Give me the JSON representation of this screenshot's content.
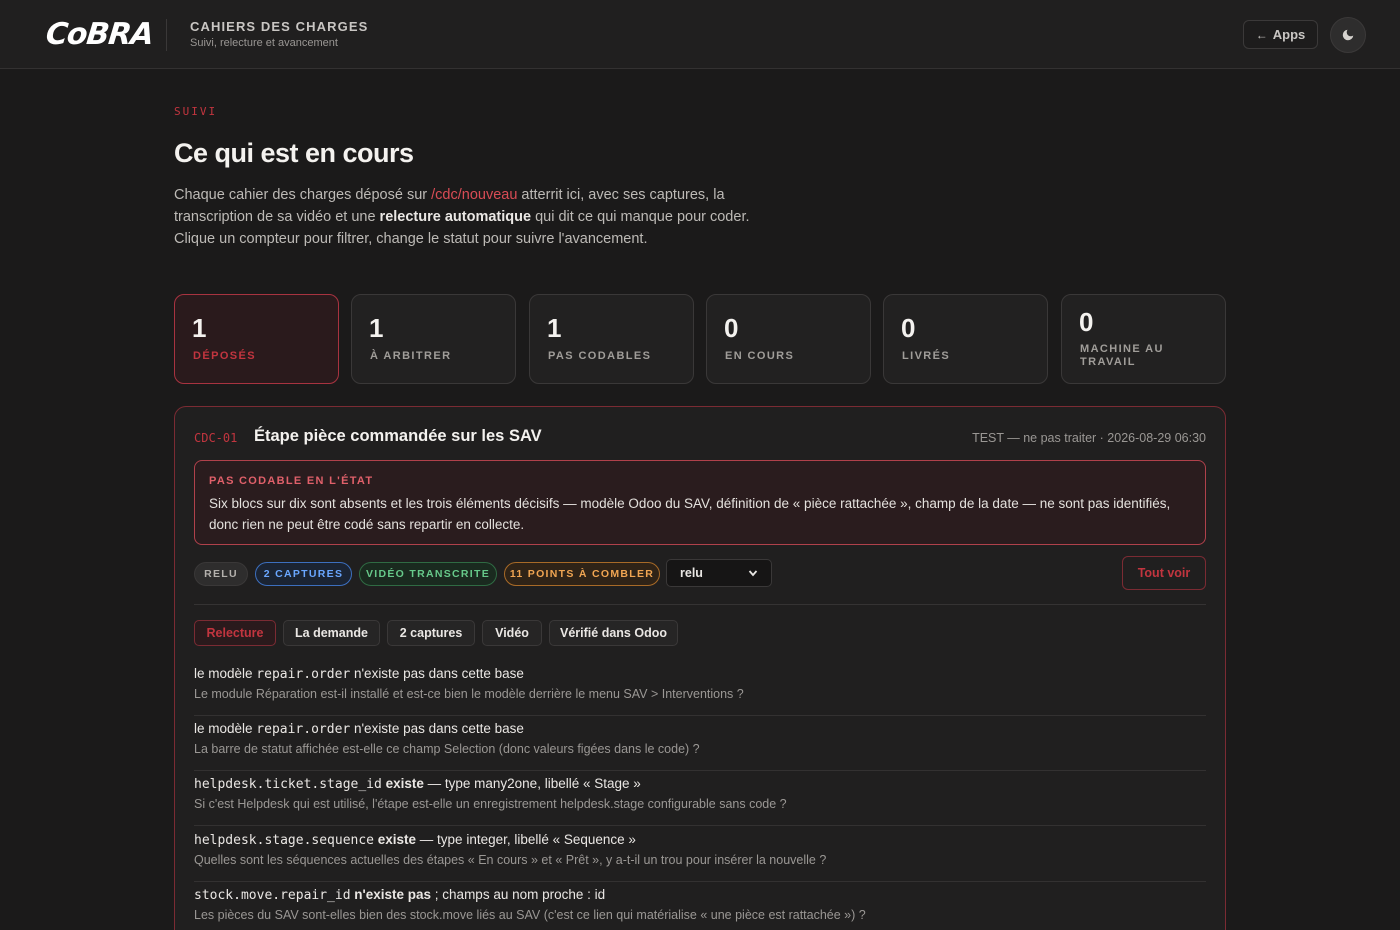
{
  "header": {
    "logo": "CoBRA",
    "title": "CAHIERS DES CHARGES",
    "subtitle": "Suivi, relecture et avancement",
    "apps_label": "Apps",
    "theme_icon": "moon-icon"
  },
  "hero": {
    "eyebrow": "SUIVI",
    "title": "Ce qui est en cours",
    "intro_1": "Chaque cahier des charges déposé sur ",
    "intro_link": "/cdc/nouveau",
    "intro_2": " atterrit ici, avec ses captures, la transcription de sa vidéo et une ",
    "intro_bold": "relecture automatique",
    "intro_3": " qui dit ce qui manque pour coder. Clique un compteur pour filtrer, change le statut pour suivre l'avancement."
  },
  "stats": [
    {
      "count": "1",
      "label": "DÉPOSÉS"
    },
    {
      "count": "1",
      "label": "À ARBITRER"
    },
    {
      "count": "1",
      "label": "PAS CODABLES"
    },
    {
      "count": "0",
      "label": "EN COURS"
    },
    {
      "count": "0",
      "label": "LIVRÉS"
    },
    {
      "count": "0",
      "label": "MACHINE AU TRAVAIL"
    }
  ],
  "card": {
    "code": "CDC-01",
    "title": "Étape pièce commandée sur les SAV",
    "meta": "TEST — ne pas traiter · 2026-08-29 06:30",
    "alert_title": "PAS CODABLE EN L'ÉTAT",
    "alert_text": "Six blocs sur dix sont absents et les trois éléments décisifs — modèle Odoo du SAV, définition de « pièce rattachée », champ de la date — ne sont pas identifiés, donc rien ne peut être codé sans repartir en collecte.",
    "pills": {
      "relu": "RELU",
      "captures": "2 CAPTURES",
      "video": "VIDÉO TRANSCRITE",
      "points": "11 POINTS À COMBLER"
    },
    "status_value": "relu",
    "voir_label": "Tout voir",
    "tabs": [
      "Relecture",
      "La demande",
      "2 captures",
      "Vidéo",
      "Vérifié dans Odoo"
    ],
    "items": [
      {
        "pre": "le modèle ",
        "code": "repair.order",
        "post": " n'existe pas dans cette base",
        "sub": "Le module Réparation est-il installé et est-ce bien le modèle derrière le menu SAV > Interventions ?"
      },
      {
        "pre": "le modèle ",
        "code": "repair.order",
        "post": " n'existe pas dans cette base",
        "sub": "La barre de statut affichée est-elle ce champ Selection (donc valeurs figées dans le code) ?"
      },
      {
        "code": "helpdesk.ticket.stage_id",
        "bold": " existe",
        "post": " — type many2one, libellé « Stage »",
        "sub": "Si c'est Helpdesk qui est utilisé, l'étape est-elle un enregistrement helpdesk.stage configurable sans code ?"
      },
      {
        "code": "helpdesk.stage.sequence",
        "bold": " existe",
        "post": " — type integer, libellé « Sequence »",
        "sub": "Quelles sont les séquences actuelles des étapes « En cours » et « Prêt », y a-t-il un trou pour insérer la nouvelle ?"
      },
      {
        "code": "stock.move.repair_id",
        "bold": " n'existe pas",
        "post": " ; champs au nom proche : id",
        "sub": "Les pièces du SAV sont-elles bien des stock.move liés au SAV (c'est ce lien qui matérialise « une pièce est rattachée ») ?"
      }
    ]
  }
}
